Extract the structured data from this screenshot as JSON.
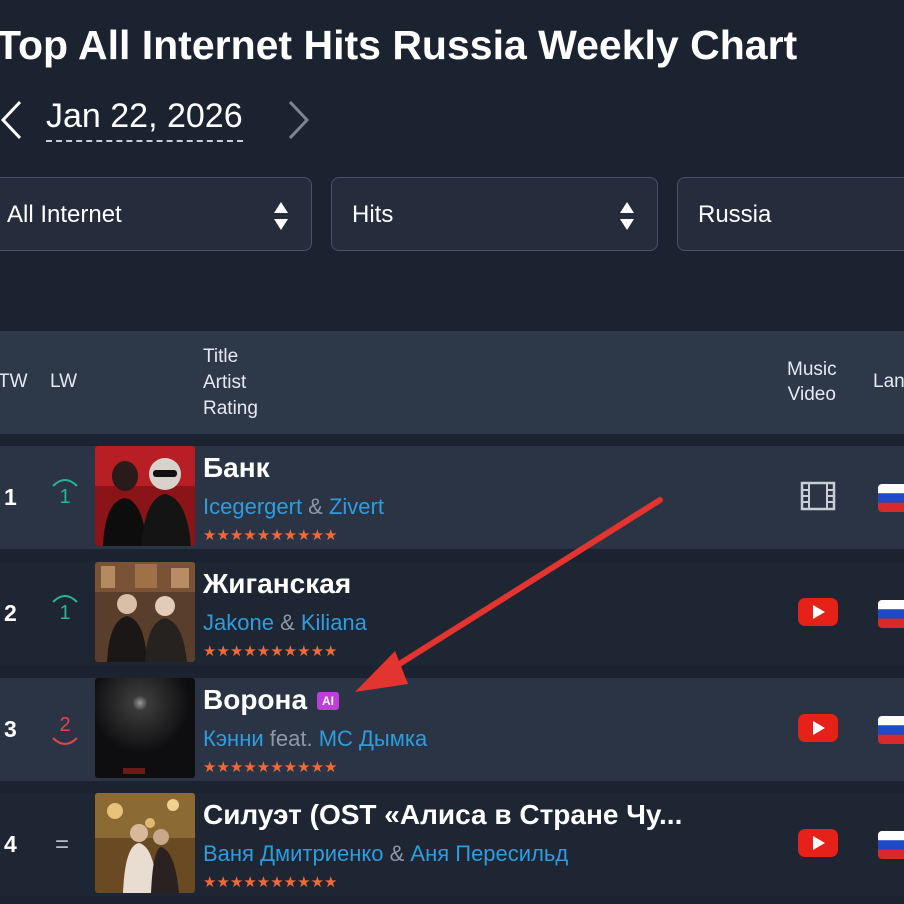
{
  "page": {
    "title": "Top All Internet Hits Russia Weekly Chart",
    "date": "Jan 22, 2026"
  },
  "filters": [
    {
      "label": "All Internet"
    },
    {
      "label": "Hits"
    },
    {
      "label": "Russia"
    }
  ],
  "table": {
    "headers": {
      "tw": "TW",
      "lw": "LW",
      "title": "Title",
      "artist": "Artist",
      "rating": "Rating",
      "music_video_line1": "Music",
      "music_video_line2": "Video",
      "language": "Lan"
    },
    "rows": [
      {
        "tw": "1",
        "lw": "1",
        "movement": "up",
        "title": "Банк",
        "ai": "",
        "artist1": "Icegergert",
        "joiner": " & ",
        "artist2": "Zivert",
        "stars": "★★★★★★★★★★",
        "video": "film-icon"
      },
      {
        "tw": "2",
        "lw": "1",
        "movement": "up",
        "title": "Жиганская",
        "ai": "",
        "artist1": "Jakone",
        "joiner": " & ",
        "artist2": "Kiliana",
        "stars": "★★★★★★★★★★",
        "video": "youtube-icon"
      },
      {
        "tw": "3",
        "lw": "2",
        "movement": "down",
        "title": "Ворона",
        "ai": "AI",
        "artist1": "Кэнни",
        "joiner": " feat. ",
        "artist2": "МС Дымка",
        "stars": "★★★★★★★★★★",
        "video": "youtube-icon"
      },
      {
        "tw": "4",
        "lw": "=",
        "movement": "same",
        "title": "Силуэт (OST «Алиса в Стране Чу...",
        "ai": "",
        "artist1": "Ваня Дмитриенко",
        "joiner": " & ",
        "artist2": "Аня Пересильд",
        "stars": "★★★★★★★★★★",
        "video": "youtube-icon"
      }
    ]
  },
  "colors": {
    "background": "#1b2230",
    "link": "#2d9de0",
    "stars": "#ef6a3a",
    "up": "#2bb39a",
    "down": "#e0474c",
    "ai_badge": "#c13cdc",
    "annotation_arrow": "#e3342f",
    "youtube": "#e62117"
  }
}
